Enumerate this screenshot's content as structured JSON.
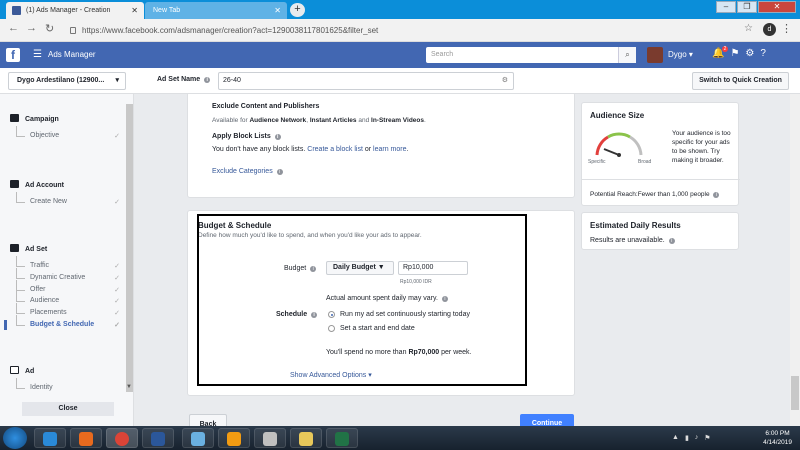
{
  "browser": {
    "tabs": [
      {
        "label": "(1) Ads Manager - Creation",
        "active": true
      },
      {
        "label": "New Tab",
        "active": false
      }
    ],
    "url": "https://www.facebook.com/adsmanager/creation?act=1290038117801625&filter_set",
    "profile_initial": "d"
  },
  "fb_header": {
    "logo": "f",
    "app_name": "Ads Manager",
    "search_placeholder": "Search",
    "user_name": "Dygo",
    "notification_count": "2"
  },
  "subheader": {
    "account": "Dygo Ardestilano (12900...",
    "ad_set_name_label": "Ad Set Name",
    "ad_set_name_value": "26-40",
    "quick_creation_button": "Switch to Quick Creation"
  },
  "sidebar": {
    "campaign": {
      "label": "Campaign",
      "items": [
        "Objective"
      ]
    },
    "ad_account": {
      "label": "Ad Account",
      "items": [
        "Create New"
      ]
    },
    "ad_set": {
      "label": "Ad Set",
      "items": [
        "Traffic",
        "Dynamic Creative",
        "Offer",
        "Audience",
        "Placements",
        "Budget & Schedule"
      ]
    },
    "ad": {
      "label": "Ad",
      "items": [
        "Identity"
      ]
    },
    "close_button": "Close"
  },
  "exclusions": {
    "title": "Exclude Content and Publishers",
    "available_prefix": "Available for",
    "audience_network": "Audience Network",
    "sep1": ",",
    "instant_articles": "Instant Articles",
    "and": "and",
    "instream": "In-Stream Videos",
    "period": ".",
    "block_lists_title": "Apply Block Lists",
    "block_lists_text": "You don't have any block lists.",
    "create_block_list": "Create a block list",
    "or": "or",
    "learn_more": "learn more",
    "exclude_categories": "Exclude Categories"
  },
  "budget_schedule": {
    "title": "Budget & Schedule",
    "subtitle": "Define how much you'd like to spend, and when you'd like your ads to appear.",
    "budget_label": "Budget",
    "budget_type": "Daily Budget",
    "budget_value": "Rp10,000",
    "budget_hint": "Rp10,000 IDR",
    "actual_spend_note": "Actual amount spent daily may vary.",
    "schedule_label": "Schedule",
    "schedule_options": [
      {
        "label": "Run my ad set continuously starting today",
        "selected": true
      },
      {
        "label": "Set a start and end date",
        "selected": false
      }
    ],
    "weekly_prefix": "You'll spend no more than",
    "weekly_amount": "Rp70,000",
    "weekly_suffix": "per week.",
    "advanced_options": "Show Advanced Options"
  },
  "audience_size": {
    "title": "Audience Size",
    "gauge_left": "Specific",
    "gauge_right": "Broad",
    "message": "Your audience is too specific for your ads to be shown. Try making it broader.",
    "potential_reach": "Potential Reach:Fewer than 1,000 people"
  },
  "estimated_daily_results": {
    "title": "Estimated Daily Results",
    "text": "Results are unavailable."
  },
  "footer_buttons": {
    "back": "Back",
    "continue": "Continue"
  },
  "taskbar": {
    "time": "6:00 PM",
    "date": "4/14/2019"
  },
  "colors": {
    "fb_blue": "#4267b2",
    "link": "#365899",
    "continue_button": "#4080ff",
    "tab_strip": "#0b8ed9"
  }
}
